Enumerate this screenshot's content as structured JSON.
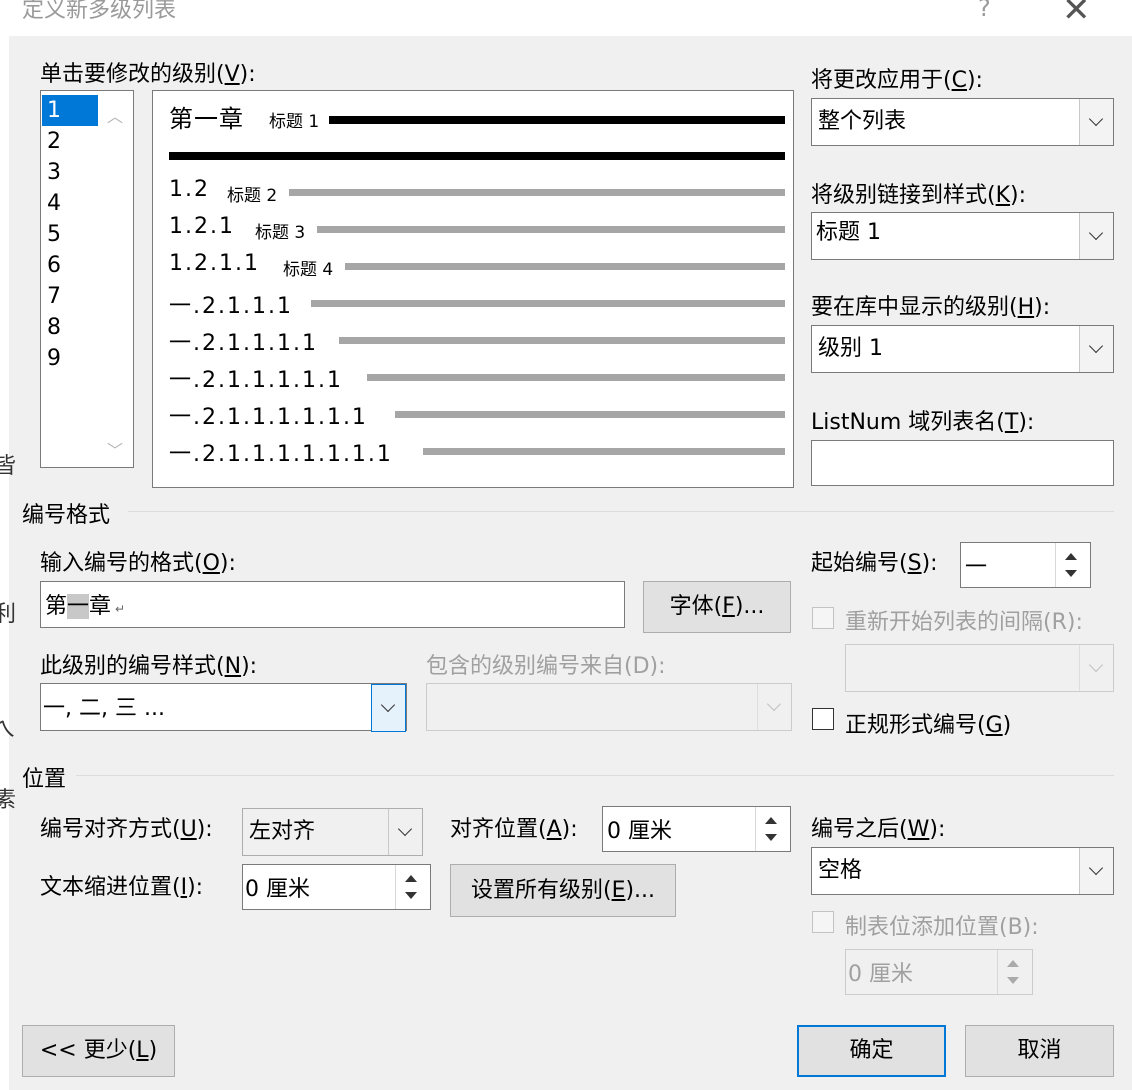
{
  "window": {
    "title": "定义新多级列表",
    "help_glyph": "?",
    "close_glyph": "✕"
  },
  "left_strip": [
    "皆",
    "利",
    "ㄟ",
    "素"
  ],
  "levels": {
    "label_pre": "单击要修改的级别(",
    "label_key": "V",
    "label_post": "):",
    "items": [
      "1",
      "2",
      "3",
      "4",
      "5",
      "6",
      "7",
      "8",
      "9"
    ],
    "selected": "1"
  },
  "preview": {
    "line1_num": "第一章",
    "line1_style": "标题 1",
    "rows": [
      {
        "num": "1.2",
        "style": "标题 2"
      },
      {
        "num": "1.2.1",
        "style": "标题 3"
      },
      {
        "num": "1.2.1.1",
        "style": "标题 4"
      },
      {
        "num": "一.2.1.1.1",
        "style": ""
      },
      {
        "num": "一.2.1.1.1.1",
        "style": ""
      },
      {
        "num": "一.2.1.1.1.1.1",
        "style": ""
      },
      {
        "num": "一.2.1.1.1.1.1.1",
        "style": ""
      },
      {
        "num": "一.2.1.1.1.1.1.1.1",
        "style": ""
      }
    ]
  },
  "apply_to": {
    "label_pre": "将更改应用于(",
    "label_key": "C",
    "label_post": "):",
    "value": "整个列表"
  },
  "link_style": {
    "label_pre": "将级别链接到样式(",
    "label_key": "K",
    "label_post": "):",
    "value": "标题 1"
  },
  "gallery_level": {
    "label_pre": "要在库中显示的级别(",
    "label_key": "H",
    "label_post": "):",
    "value": "级别 1"
  },
  "listnum": {
    "label_pre": "ListNum 域列表名(",
    "label_key": "T",
    "label_post": "):",
    "value": ""
  },
  "number_format": {
    "section": "编号格式",
    "input_label_pre": "输入编号的格式(",
    "input_label_key": "O",
    "input_label_post": "):",
    "input_before": "第",
    "input_field": "一",
    "input_after": "章",
    "input_mark": "↵",
    "font_button_pre": "字体(",
    "font_button_key": "F",
    "font_button_post": ")...",
    "style_label_pre": "此级别的编号样式(",
    "style_label_key": "N",
    "style_label_post": "):",
    "style_value": "一, 二, 三 ...",
    "include_label": "包含的级别编号来自(D):",
    "include_value": "",
    "start_label_pre": "起始编号(",
    "start_label_key": "S",
    "start_label_post": "):",
    "start_value": "一",
    "restart_label": "重新开始列表的间隔(R):",
    "restart_value": "",
    "legal_label_pre": "正规形式编号(",
    "legal_label_key": "G",
    "legal_label_post": ")",
    "legal_checked": false
  },
  "position": {
    "section": "位置",
    "align_label_pre": "编号对齐方式(",
    "align_label_key": "U",
    "align_label_post": "):",
    "align_value": "左对齐",
    "align_at_label_pre": "对齐位置(",
    "align_at_label_key": "A",
    "align_at_label_post": "):",
    "align_at_value": "0 厘米",
    "indent_label_pre": "文本缩进位置(",
    "indent_label_key": "I",
    "indent_label_post": "):",
    "indent_value": "0 厘米",
    "set_all_pre": "设置所有级别(",
    "set_all_key": "E",
    "set_all_post": ")...",
    "follow_label_pre": "编号之后(",
    "follow_label_key": "W",
    "follow_label_post": "):",
    "follow_value": "空格",
    "tab_label": "制表位添加位置(B):",
    "tab_value": "0 厘米"
  },
  "footer": {
    "less_pre": "<< 更少(",
    "less_key": "L",
    "less_post": ")",
    "ok": "确定",
    "cancel": "取消"
  },
  "colors": {
    "accent": "#0078d7",
    "preview_heavy": "#000000",
    "preview_light": "#a6a6a6"
  }
}
